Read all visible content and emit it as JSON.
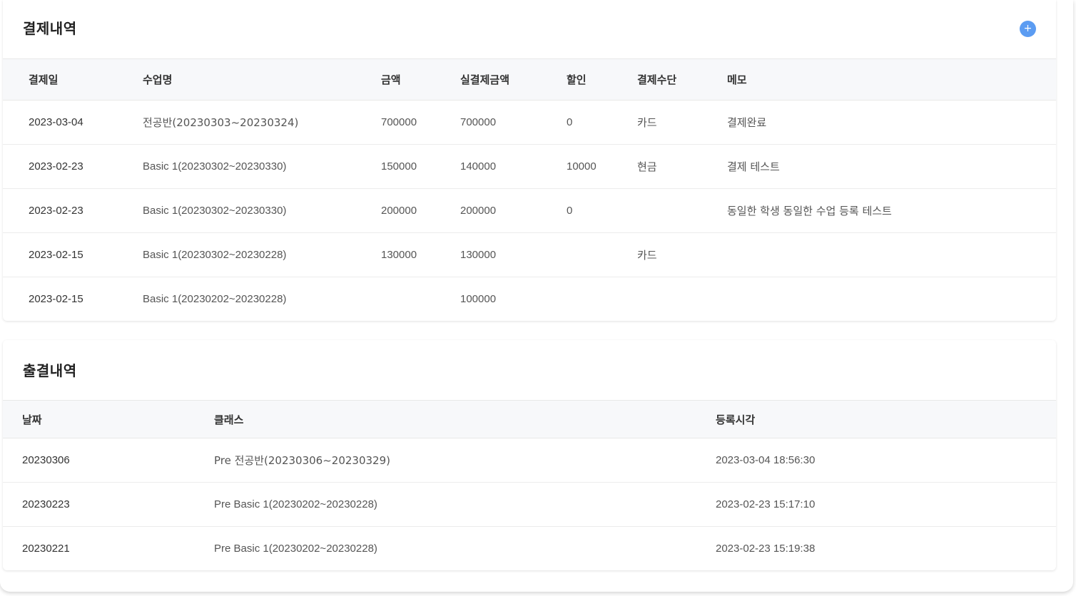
{
  "payments": {
    "title": "결제내역",
    "add_label": "+",
    "columns": [
      "결제일",
      "수업명",
      "금액",
      "실결제금액",
      "할인",
      "결제수단",
      "메모"
    ],
    "rows": [
      [
        "2023-03-04",
        "전공반(20230303~20230324)",
        "700000",
        "700000",
        "0",
        "카드",
        "결제완료"
      ],
      [
        "2023-02-23",
        "Basic 1(20230302~20230330)",
        "150000",
        "140000",
        "10000",
        "현금",
        "결제 테스트"
      ],
      [
        "2023-02-23",
        "Basic 1(20230302~20230330)",
        "200000",
        "200000",
        "0",
        "",
        "동일한 학생 동일한 수업 등록 테스트"
      ],
      [
        "2023-02-15",
        "Basic 1(20230302~20230228)",
        "130000",
        "130000",
        "",
        "카드",
        ""
      ],
      [
        "2023-02-15",
        "Basic 1(20230202~20230228)",
        "",
        "100000",
        "",
        "",
        ""
      ]
    ]
  },
  "attendance": {
    "title": "출결내역",
    "columns": [
      "날짜",
      "클래스",
      "등록시각"
    ],
    "rows": [
      [
        "20230306",
        "Pre 전공반(20230306~20230329)",
        "2023-03-04 18:56:30"
      ],
      [
        "20230223",
        "Pre Basic 1(20230202~20230228)",
        "2023-02-23 15:17:10"
      ],
      [
        "20230221",
        "Pre Basic 1(20230202~20230228)",
        "2023-02-23 15:19:38"
      ]
    ]
  }
}
